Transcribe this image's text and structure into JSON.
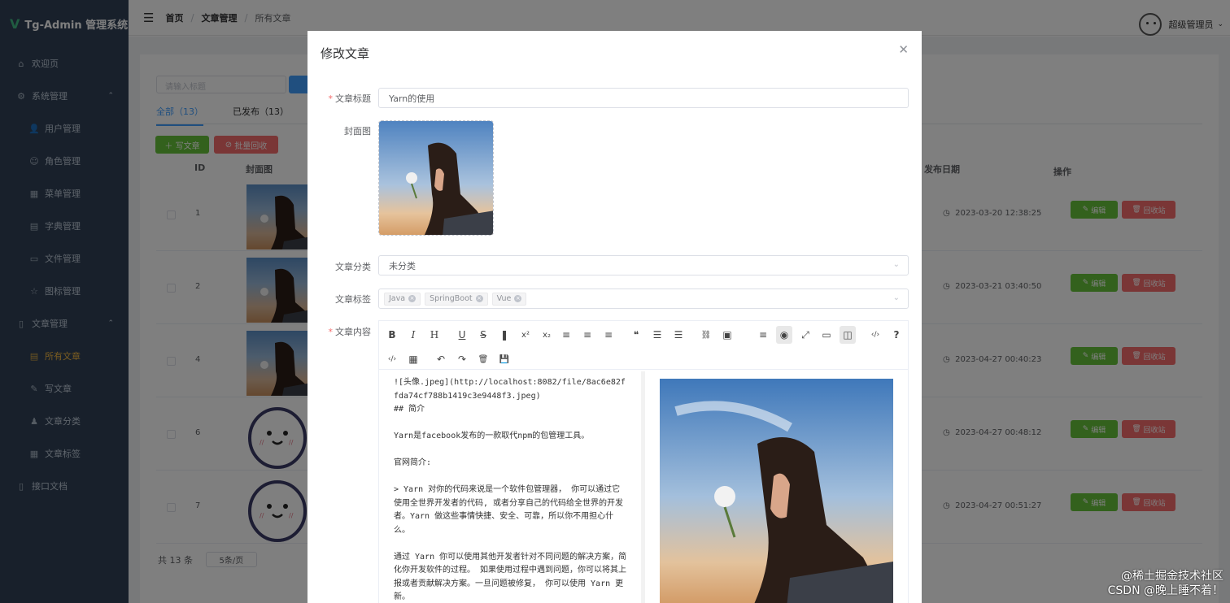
{
  "app": {
    "title": "Tg-Admin 管理系统"
  },
  "sidebar": {
    "items": [
      {
        "label": "欢迎页",
        "icon": "home-icon",
        "sub": false,
        "active": false
      },
      {
        "label": "系统管理",
        "icon": "gear-icon",
        "sub": false,
        "active": false,
        "expandable": true
      },
      {
        "label": "用户管理",
        "icon": "user-icon",
        "sub": true,
        "active": false
      },
      {
        "label": "角色管理",
        "icon": "user-outline-icon",
        "sub": true,
        "active": false
      },
      {
        "label": "菜单管理",
        "icon": "grid-icon",
        "sub": true,
        "active": false
      },
      {
        "label": "字典管理",
        "icon": "notebook-icon",
        "sub": true,
        "active": false
      },
      {
        "label": "文件管理",
        "icon": "folder-icon",
        "sub": true,
        "active": false
      },
      {
        "label": "图标管理",
        "icon": "star-icon",
        "sub": true,
        "active": false
      },
      {
        "label": "文章管理",
        "icon": "document-icon",
        "sub": false,
        "active": false,
        "expandable": true
      },
      {
        "label": "所有文章",
        "icon": "notebook-icon",
        "sub": true,
        "active": true
      },
      {
        "label": "写文章",
        "icon": "edit-icon",
        "sub": true,
        "active": false
      },
      {
        "label": "文章分类",
        "icon": "bell-icon",
        "sub": true,
        "active": false
      },
      {
        "label": "文章标签",
        "icon": "grid-icon",
        "sub": true,
        "active": false
      },
      {
        "label": "接口文档",
        "icon": "document-icon",
        "sub": false,
        "active": false
      }
    ]
  },
  "header": {
    "breadcrumb": [
      "首页",
      "文章管理",
      "所有文章"
    ],
    "user_name": "超级管理员"
  },
  "list": {
    "search_placeholder": "请输入标题",
    "tabs": [
      "全部（13）",
      "已发布（13）"
    ],
    "write_button": "写文章",
    "batch_recycle_button": "批量回收",
    "columns": {
      "id": "ID",
      "cover": "封面图",
      "date": "发布日期",
      "ops": "操作"
    },
    "rows": [
      {
        "id": "1",
        "date": "2023-03-20 12:38:25",
        "cover": "photo"
      },
      {
        "id": "2",
        "date": "2023-03-21 03:40:50",
        "cover": "photo"
      },
      {
        "id": "4",
        "date": "2023-04-27 00:40:23",
        "cover": "photo"
      },
      {
        "id": "6",
        "date": "2023-04-27 00:48:12",
        "cover": "face"
      },
      {
        "id": "7",
        "date": "2023-04-27 00:51:27",
        "cover": "face"
      }
    ],
    "edit_label": "编辑",
    "recycle_label": "回收站",
    "total": "共 13 条",
    "page_size": "5条/页"
  },
  "dialog": {
    "title": "修改文章",
    "title_label": "文章标题",
    "title_value": "Yarn的使用",
    "cover_label": "封面图",
    "category_label": "文章分类",
    "category_value": "未分类",
    "tags_label": "文章标签",
    "tags": [
      "Java",
      "SpringBoot",
      "Vue"
    ],
    "content_label": "文章内容",
    "markdown": "![头像.jpeg](http://localhost:8082/file/8ac6e82ffda74cf788b1419c3e9448f3.jpeg)\n## 简介\n\nYarn是facebook发布的一款取代npm的包管理工具。\n\n官网简介:\n\n> Yarn 对你的代码来说是一个软件包管理器， 你可以通过它使用全世界开发者的代码, 或者分享自己的代码给全世界的开发者。Yarn 做这些事情快捷、安全、可靠，所以你不用担心什么。\n\n通过 Yarn 你可以使用其他开发者针对不同问题的解决方案，简化你开发软件的过程。 如果使用过程中遇到问题，你可以将其上报或者贡献解决方案。一旦问题被修复， 你可以使用 Yarn 更新。"
  },
  "watermark": [
    "@稀土掘金技术社区",
    "CSDN @晚上睡不着！"
  ]
}
